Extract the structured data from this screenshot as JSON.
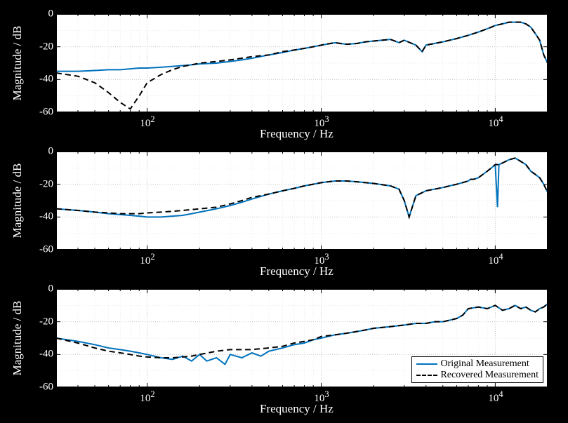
{
  "chart_data": [
    {
      "type": "line",
      "title": "",
      "xlabel": "Frequency / Hz",
      "ylabel": "Magnitude / dB",
      "xscale": "log",
      "xlim": [
        30,
        20000
      ],
      "ylim": [
        -60,
        0
      ],
      "xticks": [
        100,
        1000,
        10000
      ],
      "xticklabels": [
        "10^2",
        "10^3",
        "10^4"
      ],
      "yticks": [
        -60,
        -40,
        -20,
        0
      ],
      "yticklabels": [
        "-60",
        "-40",
        "-20",
        "0"
      ],
      "grid": true,
      "series": [
        {
          "name": "Original Measurement",
          "color": "#0072BD",
          "dash": "solid",
          "x": [
            30,
            40,
            50,
            60,
            70,
            80,
            90,
            100,
            120,
            140,
            160,
            180,
            200,
            250,
            300,
            350,
            400,
            500,
            600,
            700,
            800,
            900,
            1000,
            1200,
            1400,
            1600,
            1800,
            2000,
            2500,
            2800,
            3000,
            3500,
            3800,
            4000,
            5000,
            6000,
            7000,
            8000,
            9000,
            9500,
            10000,
            11000,
            12000,
            13000,
            14000,
            15000,
            16000,
            17000,
            18000,
            19000,
            20000
          ],
          "y": [
            -35,
            -35,
            -34.5,
            -34,
            -34,
            -33.5,
            -33,
            -33,
            -32.5,
            -32,
            -31.5,
            -31,
            -30.5,
            -30,
            -29,
            -28,
            -27,
            -25,
            -23.5,
            -22,
            -21,
            -20,
            -19,
            -17.5,
            -18.5,
            -18,
            -17,
            -16.5,
            -15.5,
            -17.5,
            -16,
            -19,
            -23,
            -19,
            -17,
            -15,
            -13,
            -11,
            -9,
            -8,
            -7,
            -6,
            -5,
            -5,
            -5,
            -6,
            -8,
            -12,
            -16,
            -25,
            -30
          ]
        },
        {
          "name": "Recovered Measurement",
          "color": "#000000",
          "dash": "dashed",
          "x": [
            30,
            40,
            50,
            60,
            70,
            80,
            90,
            100,
            120,
            140,
            160,
            180,
            200,
            250,
            300,
            350,
            400,
            500,
            600,
            700,
            800,
            900,
            1000,
            1200,
            1400,
            1600,
            1800,
            2000,
            2500,
            2800,
            3000,
            3500,
            3800,
            4000,
            5000,
            6000,
            7000,
            8000,
            9000,
            9500,
            10000,
            11000,
            12000,
            13000,
            14000,
            15000,
            16000,
            17000,
            18000,
            19000,
            20000
          ],
          "y": [
            -36,
            -38,
            -42,
            -48,
            -54,
            -58,
            -50,
            -42,
            -37,
            -34,
            -32,
            -31,
            -30,
            -29,
            -28,
            -27,
            -26,
            -25,
            -23,
            -22,
            -21,
            -20,
            -19,
            -17.5,
            -18.5,
            -18,
            -17,
            -16.5,
            -15.5,
            -17.5,
            -16,
            -19,
            -23,
            -19,
            -17,
            -15,
            -13,
            -11,
            -9,
            -8,
            -7,
            -6,
            -5,
            -5,
            -5,
            -6,
            -8,
            -12,
            -16,
            -25,
            -30
          ]
        }
      ]
    },
    {
      "type": "line",
      "title": "",
      "xlabel": "Frequency / Hz",
      "ylabel": "Magnitude / dB",
      "xscale": "log",
      "xlim": [
        30,
        20000
      ],
      "ylim": [
        -60,
        0
      ],
      "xticks": [
        100,
        1000,
        10000
      ],
      "xticklabels": [
        "10^2",
        "10^3",
        "10^4"
      ],
      "yticks": [
        -60,
        -40,
        -20,
        0
      ],
      "yticklabels": [
        "-60",
        "-40",
        "-20",
        "0"
      ],
      "grid": true,
      "series": [
        {
          "name": "Original Measurement",
          "color": "#0072BD",
          "dash": "solid",
          "x": [
            30,
            40,
            50,
            60,
            70,
            80,
            90,
            100,
            120,
            140,
            160,
            180,
            200,
            250,
            300,
            350,
            400,
            500,
            600,
            700,
            800,
            900,
            1000,
            1200,
            1400,
            1600,
            1800,
            2000,
            2500,
            2800,
            3000,
            3200,
            3500,
            4000,
            5000,
            6000,
            6500,
            7000,
            7200,
            7500,
            8000,
            9000,
            9500,
            10000,
            10300,
            10500,
            11000,
            12000,
            13000,
            14000,
            15000,
            16000,
            17000,
            18000,
            19000,
            20000
          ],
          "y": [
            -35,
            -36,
            -37,
            -38,
            -38.5,
            -39,
            -39.5,
            -40,
            -40,
            -39.5,
            -39,
            -38,
            -37,
            -35,
            -33,
            -31,
            -29,
            -26,
            -24,
            -22.5,
            -21,
            -20,
            -19,
            -18,
            -18,
            -18.5,
            -19,
            -19.5,
            -21,
            -23,
            -30,
            -40,
            -27,
            -24,
            -22,
            -20,
            -19,
            -18,
            -17,
            -17,
            -16,
            -12,
            -10,
            -8,
            -34,
            -8,
            -7,
            -5,
            -4,
            -6,
            -8,
            -12,
            -14,
            -16,
            -20,
            -25
          ]
        },
        {
          "name": "Recovered Measurement",
          "color": "#000000",
          "dash": "dashed",
          "x": [
            30,
            40,
            50,
            60,
            70,
            80,
            90,
            100,
            120,
            140,
            160,
            180,
            200,
            250,
            300,
            350,
            400,
            500,
            600,
            700,
            800,
            900,
            1000,
            1200,
            1400,
            1600,
            1800,
            2000,
            2500,
            2800,
            3000,
            3200,
            3500,
            4000,
            5000,
            6000,
            6500,
            7000,
            7200,
            7500,
            8000,
            9000,
            9500,
            10000,
            10500,
            11000,
            12000,
            13000,
            14000,
            15000,
            16000,
            17000,
            18000,
            19000,
            20000
          ],
          "y": [
            -35,
            -36,
            -37,
            -37.5,
            -38,
            -38,
            -38,
            -37.5,
            -37,
            -36.5,
            -36,
            -35.5,
            -35,
            -34,
            -32,
            -30,
            -28,
            -26,
            -24,
            -22.5,
            -21,
            -20,
            -19,
            -18,
            -18,
            -18.5,
            -19,
            -19.5,
            -21,
            -23,
            -30,
            -40,
            -27,
            -24,
            -22,
            -20,
            -19,
            -18,
            -17,
            -17,
            -16,
            -12,
            -10,
            -8,
            -8,
            -7,
            -5,
            -4,
            -6,
            -8,
            -12,
            -14,
            -16,
            -20,
            -25
          ]
        }
      ]
    },
    {
      "type": "line",
      "title": "",
      "xlabel": "Frequency / Hz",
      "ylabel": "Magnitude / dB",
      "xscale": "log",
      "xlim": [
        30,
        20000
      ],
      "ylim": [
        -60,
        0
      ],
      "xticks": [
        100,
        1000,
        10000
      ],
      "xticklabels": [
        "10^2",
        "10^3",
        "10^4"
      ],
      "yticks": [
        -60,
        -40,
        -20,
        0
      ],
      "yticklabels": [
        "-60",
        "-40",
        "-20",
        "0"
      ],
      "grid": true,
      "legend_position": "lower-right",
      "series": [
        {
          "name": "Original Measurement",
          "color": "#0072BD",
          "dash": "solid",
          "x": [
            30,
            40,
            50,
            60,
            70,
            80,
            90,
            100,
            120,
            140,
            160,
            180,
            200,
            220,
            250,
            280,
            300,
            350,
            400,
            450,
            500,
            600,
            700,
            800,
            900,
            1000,
            1200,
            1400,
            1600,
            1800,
            2000,
            2500,
            3000,
            3500,
            4000,
            4500,
            5000,
            5500,
            6000,
            6500,
            7000,
            8000,
            9000,
            10000,
            11000,
            12000,
            13000,
            14000,
            15000,
            16000,
            17000,
            18000,
            19000,
            20000
          ],
          "y": [
            -30,
            -32,
            -34,
            -36,
            -37,
            -38,
            -39,
            -40,
            -42,
            -43,
            -41,
            -44,
            -40,
            -44,
            -42,
            -46,
            -40,
            -42,
            -39,
            -41,
            -38,
            -36,
            -34,
            -33,
            -31,
            -30,
            -28,
            -27,
            -26,
            -25,
            -24,
            -23,
            -22,
            -21,
            -21,
            -20,
            -20,
            -19,
            -18,
            -16,
            -12,
            -11,
            -12,
            -10,
            -13,
            -12,
            -10,
            -12,
            -11,
            -13,
            -14,
            -12,
            -11,
            -9
          ]
        },
        {
          "name": "Recovered Measurement",
          "color": "#000000",
          "dash": "dashed",
          "x": [
            30,
            40,
            50,
            60,
            70,
            80,
            90,
            100,
            120,
            140,
            160,
            180,
            200,
            250,
            300,
            350,
            400,
            500,
            600,
            700,
            800,
            900,
            1000,
            1200,
            1400,
            1600,
            1800,
            2000,
            2500,
            3000,
            3500,
            4000,
            4500,
            5000,
            5500,
            6000,
            6500,
            7000,
            8000,
            9000,
            10000,
            11000,
            12000,
            13000,
            14000,
            15000,
            16000,
            17000,
            18000,
            19000,
            20000
          ],
          "y": [
            -30,
            -33,
            -36,
            -38,
            -39,
            -40,
            -41,
            -41.5,
            -42,
            -42,
            -41.5,
            -41,
            -40,
            -38,
            -37,
            -37,
            -37,
            -36,
            -35,
            -33,
            -32,
            -31,
            -29,
            -28,
            -27,
            -26,
            -25,
            -24,
            -23,
            -22,
            -21,
            -21,
            -20,
            -20,
            -19,
            -18,
            -16,
            -12,
            -11,
            -12,
            -10,
            -13,
            -12,
            -10,
            -12,
            -11,
            -13,
            -14,
            -12,
            -11,
            -9
          ]
        }
      ]
    }
  ],
  "legend": {
    "entries": [
      "Original Measurement",
      "Recovered Measurement"
    ]
  },
  "axis_labels": {
    "x": "Frequency / Hz",
    "y": "Magnitude / dB"
  },
  "xticklabels": {
    "0": "10",
    "1": "10",
    "2": "10",
    "e0": "2",
    "e1": "3",
    "e2": "4"
  },
  "yticklabels": {
    "0": "-60",
    "1": "-40",
    "2": "-20",
    "3": "0"
  }
}
